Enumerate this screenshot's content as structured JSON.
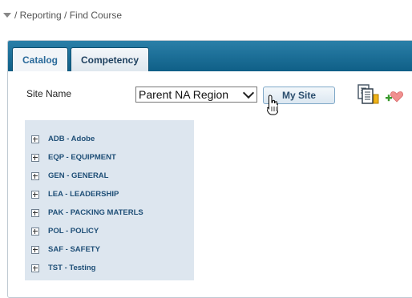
{
  "breadcrumb": {
    "text": "/ Reporting / Find Course"
  },
  "tabs": [
    {
      "label": "Catalog",
      "active": true
    },
    {
      "label": "Competency",
      "active": false
    }
  ],
  "site": {
    "label": "Site Name",
    "selected": "Parent NA Region",
    "my_site_label": "My Site"
  },
  "tree": {
    "items": [
      "ADB - Adobe",
      "EQP - EQUIPMENT",
      "GEN - GENERAL",
      "LEA - LEADERSHIP",
      "PAK - PACKING MATERLS",
      "POL - POLICY",
      "SAF - SAFETY",
      "TST - Testing"
    ]
  },
  "icons": {
    "breadcrumb": "collapse-triangle-icon",
    "copy": "copy-documents-icon",
    "favorite": "add-favorite-icon",
    "cursor": "hand-pointer-icon",
    "expander": "plus-box-icon"
  },
  "colors": {
    "tab_bar": "#1f6f98",
    "tree_background": "#dde6ef",
    "tree_text": "#1f4f77"
  }
}
